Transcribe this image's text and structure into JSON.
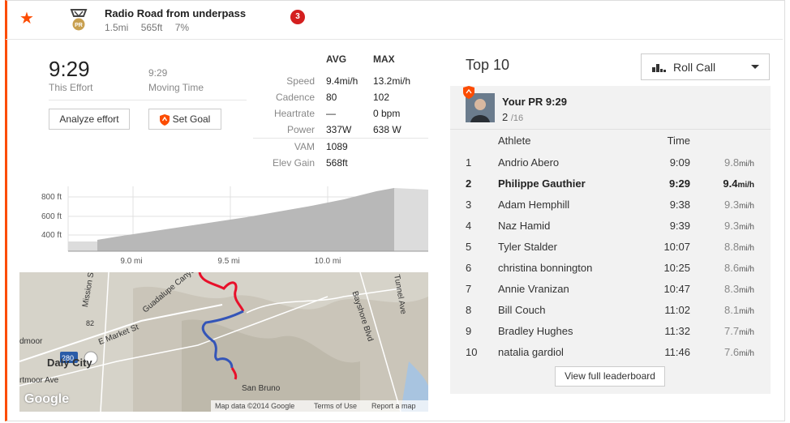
{
  "segment": {
    "title": "Radio Road from underpass",
    "distance": "1.5mi",
    "elevation": "565ft",
    "grade": "7%",
    "count_badge": "3",
    "pr_badge_label": "PR"
  },
  "effort": {
    "time": "9:29",
    "time_label": "This Effort",
    "moving_time": "9:29",
    "moving_label": "Moving Time",
    "analyze_label": "Analyze effort",
    "goal_label": "Set Goal"
  },
  "stats": {
    "avg_header": "AVG",
    "max_header": "MAX",
    "rows": [
      {
        "label": "Speed",
        "avg": "9.4mi/h",
        "max": "13.2mi/h"
      },
      {
        "label": "Cadence",
        "avg": "80",
        "max": "102"
      },
      {
        "label": "Heartrate",
        "avg": "—",
        "max": "0 bpm"
      },
      {
        "label": "Power",
        "avg": "337W",
        "max": "638 W"
      },
      {
        "label": "VAM",
        "avg": "1089",
        "max": ""
      },
      {
        "label": "Elev Gain",
        "avg": "568ft",
        "max": ""
      }
    ]
  },
  "elevation_chart": {
    "y_ticks": [
      "800 ft",
      "600 ft",
      "400 ft"
    ],
    "x_ticks": [
      "9.0 mi",
      "9.5 mi",
      "10.0 mi"
    ]
  },
  "map": {
    "labels": [
      "Mission St",
      "Guadalupe Canyon Pkwy",
      "Bayshore Blvd",
      "Tunnel Ave",
      "E Market St",
      "280",
      "82",
      "Daly City",
      "dmoor",
      "rtmoor Ave",
      "San Bruno"
    ],
    "google": "Google",
    "attribution": "Map data ©2014 Google",
    "terms": "Terms of Use",
    "report": "Report a map error"
  },
  "leaderboard": {
    "title": "Top 10",
    "filter": "Roll Call",
    "pr_label": "Your PR 9:29",
    "pr_rank": "2",
    "pr_total": "/16",
    "athlete_header": "Athlete",
    "time_header": "Time",
    "speed_unit": "mi/h",
    "rows": [
      {
        "rank": "1",
        "name": "Andrio Abero",
        "time": "9:09",
        "speed": "9.8"
      },
      {
        "rank": "2",
        "name": "Philippe Gauthier",
        "time": "9:29",
        "speed": "9.4"
      },
      {
        "rank": "3",
        "name": "Adam Hemphill",
        "time": "9:38",
        "speed": "9.3"
      },
      {
        "rank": "4",
        "name": "Naz Hamid",
        "time": "9:39",
        "speed": "9.3"
      },
      {
        "rank": "5",
        "name": "Tyler Stalder",
        "time": "10:07",
        "speed": "8.8"
      },
      {
        "rank": "6",
        "name": "christina bonnington",
        "time": "10:25",
        "speed": "8.6"
      },
      {
        "rank": "7",
        "name": "Annie Vranizan",
        "time": "10:47",
        "speed": "8.3"
      },
      {
        "rank": "8",
        "name": "Bill Couch",
        "time": "11:02",
        "speed": "8.1"
      },
      {
        "rank": "9",
        "name": "Bradley Hughes",
        "time": "11:32",
        "speed": "7.7"
      },
      {
        "rank": "10",
        "name": "natalia gardiol",
        "time": "11:46",
        "speed": "7.6"
      }
    ],
    "view_full": "View full leaderboard"
  },
  "colors": {
    "accent": "#fc4c02",
    "route_red": "#e8102a",
    "route_blue": "#3455b8",
    "badge": "#d41f1f"
  }
}
